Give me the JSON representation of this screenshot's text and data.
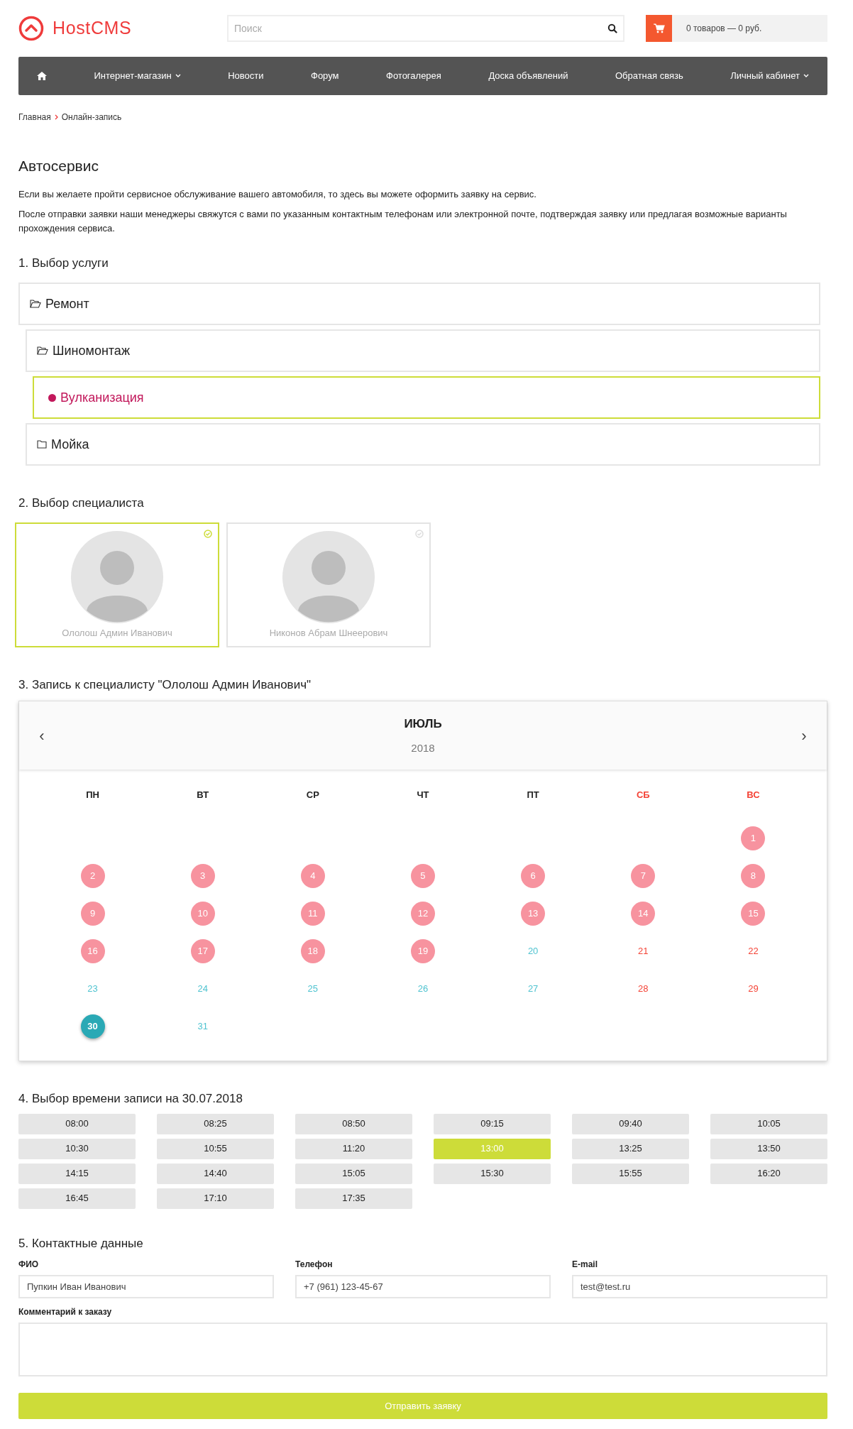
{
  "header": {
    "logo": "HostCMS",
    "search": {
      "placeholder": "Поиск"
    },
    "cart": "0 товаров — 0 руб."
  },
  "nav": [
    {
      "kind": "home"
    },
    {
      "kind": "link",
      "label": "Интернет-магазин",
      "dropdown": true
    },
    {
      "kind": "link",
      "label": "Новости",
      "dropdown": false
    },
    {
      "kind": "link",
      "label": "Форум",
      "dropdown": false
    },
    {
      "kind": "link",
      "label": "Фотогалерея",
      "dropdown": false
    },
    {
      "kind": "link",
      "label": "Доска объявлений",
      "dropdown": false
    },
    {
      "kind": "link",
      "label": "Обратная связь",
      "dropdown": false
    },
    {
      "kind": "link",
      "label": "Личный кабинет",
      "dropdown": true
    }
  ],
  "breadcrumbs": [
    "Главная",
    "Онлайн-запись"
  ],
  "title": "Автосервис",
  "paragraphs": [
    "Если вы желаете пройти сервисное обслуживание вашего автомобиля, то здесь вы можете оформить заявку на сервис.",
    "После отправки заявки наши менеджеры свяжутся с вами по указанным контактным телефонам или электронной почте, подтверждая заявку или предлагая возможные варианты прохождения сервиса."
  ],
  "services": {
    "heading": "1. Выбор услуги",
    "items": [
      {
        "label": "Ремонт",
        "kind": "folder",
        "expanded": true,
        "selected": false,
        "children": [
          {
            "label": "Шиномонтаж",
            "kind": "folder",
            "expanded": true,
            "selected": false,
            "children": [
              {
                "label": "Вулканизация",
                "kind": "item",
                "selected": true
              }
            ]
          },
          {
            "label": "Мойка",
            "kind": "folder",
            "expanded": false,
            "selected": false
          }
        ]
      }
    ]
  },
  "specialists": {
    "heading": "2. Выбор специалиста",
    "items": [
      {
        "name": "Ололош Админ Иванович",
        "selected": true
      },
      {
        "name": "Никонов Абрам Шнеерович",
        "selected": false
      }
    ]
  },
  "calendar": {
    "heading": "3. Запись к специалисту \"Ололош Админ Иванович\"",
    "prev": "‹",
    "next": "›",
    "month": "ИЮЛЬ",
    "year": "2018",
    "weekdays": [
      {
        "label": "ПН",
        "weekend": false
      },
      {
        "label": "ВТ",
        "weekend": false
      },
      {
        "label": "СР",
        "weekend": false
      },
      {
        "label": "ЧТ",
        "weekend": false
      },
      {
        "label": "ПТ",
        "weekend": false
      },
      {
        "label": "СБ",
        "weekend": true
      },
      {
        "label": "ВС",
        "weekend": true
      }
    ],
    "weeks": [
      [
        {
          "kind": "empty"
        },
        {
          "kind": "empty"
        },
        {
          "kind": "empty"
        },
        {
          "kind": "empty"
        },
        {
          "kind": "empty"
        },
        {
          "kind": "empty"
        },
        {
          "kind": "busy",
          "day": "1"
        }
      ],
      [
        {
          "kind": "busy",
          "day": "2"
        },
        {
          "kind": "busy",
          "day": "3"
        },
        {
          "kind": "busy",
          "day": "4"
        },
        {
          "kind": "busy",
          "day": "5"
        },
        {
          "kind": "busy",
          "day": "6"
        },
        {
          "kind": "busy",
          "day": "7"
        },
        {
          "kind": "busy",
          "day": "8"
        }
      ],
      [
        {
          "kind": "busy",
          "day": "9"
        },
        {
          "kind": "busy",
          "day": "10"
        },
        {
          "kind": "busy",
          "day": "11"
        },
        {
          "kind": "busy",
          "day": "12"
        },
        {
          "kind": "busy",
          "day": "13"
        },
        {
          "kind": "busy",
          "day": "14"
        },
        {
          "kind": "busy",
          "day": "15"
        }
      ],
      [
        {
          "kind": "busy",
          "day": "16"
        },
        {
          "kind": "busy",
          "day": "17"
        },
        {
          "kind": "busy",
          "day": "18"
        },
        {
          "kind": "busy",
          "day": "19"
        },
        {
          "kind": "free",
          "day": "20"
        },
        {
          "kind": "free",
          "day": "21"
        },
        {
          "kind": "free",
          "day": "22"
        }
      ],
      [
        {
          "kind": "free",
          "day": "23"
        },
        {
          "kind": "free",
          "day": "24"
        },
        {
          "kind": "free",
          "day": "25"
        },
        {
          "kind": "free",
          "day": "26"
        },
        {
          "kind": "free",
          "day": "27"
        },
        {
          "kind": "free",
          "day": "28"
        },
        {
          "kind": "free",
          "day": "29"
        }
      ],
      [
        {
          "kind": "selected",
          "day": "30"
        },
        {
          "kind": "free",
          "day": "31"
        }
      ]
    ]
  },
  "times": {
    "heading": "4. Выбор времени записи на 30.07.2018",
    "slots": [
      {
        "label": "08:00",
        "selected": false
      },
      {
        "label": "08:25",
        "selected": false
      },
      {
        "label": "08:50",
        "selected": false
      },
      {
        "label": "09:15",
        "selected": false
      },
      {
        "label": "09:40",
        "selected": false
      },
      {
        "label": "10:05",
        "selected": false
      },
      {
        "label": "10:30",
        "selected": false
      },
      {
        "label": "10:55",
        "selected": false
      },
      {
        "label": "11:20",
        "selected": false
      },
      {
        "label": "13:00",
        "selected": true
      },
      {
        "label": "13:25",
        "selected": false
      },
      {
        "label": "13:50",
        "selected": false
      },
      {
        "label": "14:15",
        "selected": false
      },
      {
        "label": "14:40",
        "selected": false
      },
      {
        "label": "15:05",
        "selected": false
      },
      {
        "label": "15:30",
        "selected": false
      },
      {
        "label": "15:55",
        "selected": false
      },
      {
        "label": "16:20",
        "selected": false
      },
      {
        "label": "16:45",
        "selected": false
      },
      {
        "label": "17:10",
        "selected": false
      },
      {
        "label": "17:35",
        "selected": false
      }
    ]
  },
  "contact": {
    "heading": "5. Контактные данные",
    "fields": [
      {
        "label": "ФИО",
        "value": "Пупкин Иван Иванович"
      },
      {
        "label": "Телефон",
        "value": "+7 (961) 123-45-67"
      },
      {
        "label": "E-mail",
        "value": "test@test.ru"
      }
    ],
    "comment_label": "Комментарий к заказу",
    "submit": "Отправить заявку"
  }
}
